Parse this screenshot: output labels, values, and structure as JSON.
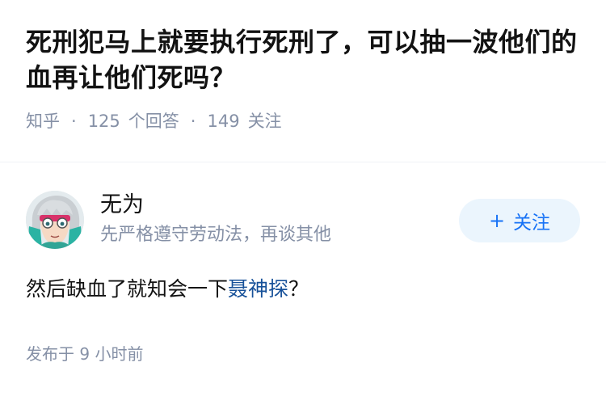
{
  "question": {
    "title": "死刑犯马上就要执行死刑了，可以抽一波他们的血再让他们死吗？",
    "source": "知乎",
    "answer_count": "125",
    "answer_label": "个回答",
    "follower_count": "149",
    "follower_label": "关注",
    "separator": "·"
  },
  "author": {
    "name": "无为",
    "bio": "先严格遵守劳动法，再谈其他",
    "avatar_icon": "anime-character-avatar",
    "follow_plus": "+",
    "follow_label": "关注"
  },
  "answer": {
    "text_before": "然后缺血了就知会一下",
    "link_text": "聂神探",
    "text_after": "？"
  },
  "footer": {
    "published": "发布于 9 小时前"
  },
  "colors": {
    "title": "#121212",
    "meta": "#8590a6",
    "follow_bg": "#ebf5fd",
    "follow_text": "#1772f6",
    "link": "#175199"
  }
}
